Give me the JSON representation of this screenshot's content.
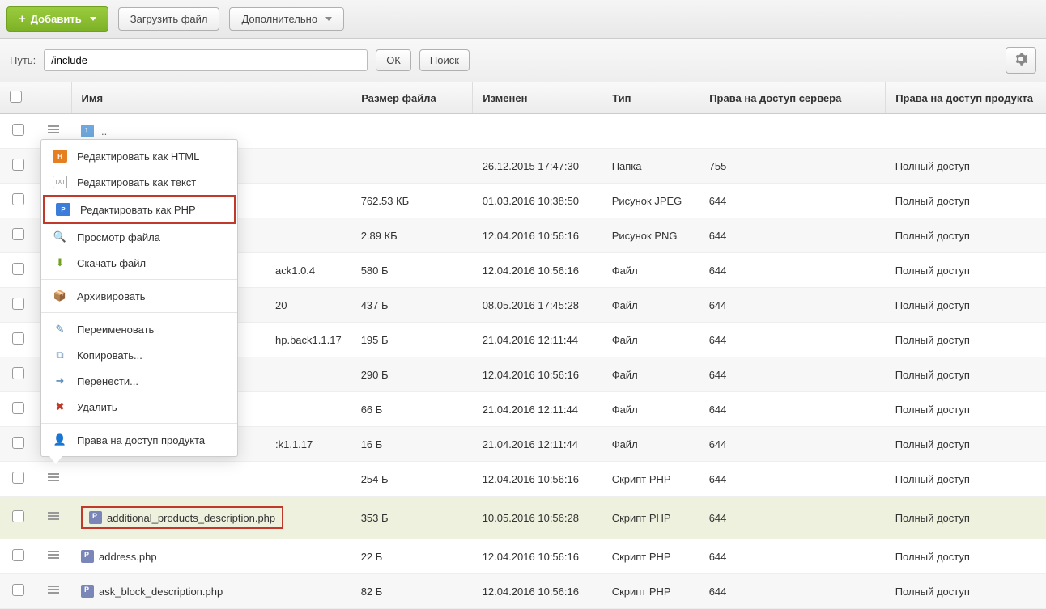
{
  "toolbar": {
    "add_label": "Добавить",
    "upload_label": "Загрузить файл",
    "more_label": "Дополнительно"
  },
  "pathbar": {
    "label": "Путь:",
    "value": "/include",
    "ok_label": "ОК",
    "search_label": "Поиск"
  },
  "columns": {
    "name": "Имя",
    "size": "Размер файла",
    "modified": "Изменен",
    "type": "Тип",
    "perm_server": "Права на доступ сервера",
    "perm_product": "Права на доступ продукта"
  },
  "parent_dots": "..",
  "rows": [
    {
      "name": "",
      "size": "",
      "modified": "26.12.2015 17:47:30",
      "type": "Папка",
      "perm_server": "755",
      "perm_product": "Полный доступ"
    },
    {
      "name": "",
      "size": "762.53 КБ",
      "modified": "01.03.2016 10:38:50",
      "type": "Рисунок JPEG",
      "perm_server": "644",
      "perm_product": "Полный доступ"
    },
    {
      "name": "",
      "size": "2.89 КБ",
      "modified": "12.04.2016 10:56:16",
      "type": "Рисунок PNG",
      "perm_server": "644",
      "perm_product": "Полный доступ"
    },
    {
      "name": "ack1.0.4",
      "size": "580 Б",
      "modified": "12.04.2016 10:56:16",
      "type": "Файл",
      "perm_server": "644",
      "perm_product": "Полный доступ"
    },
    {
      "name": "20",
      "size": "437 Б",
      "modified": "08.05.2016 17:45:28",
      "type": "Файл",
      "perm_server": "644",
      "perm_product": "Полный доступ"
    },
    {
      "name": "hp.back1.1.17",
      "size": "195 Б",
      "modified": "21.04.2016 12:11:44",
      "type": "Файл",
      "perm_server": "644",
      "perm_product": "Полный доступ"
    },
    {
      "name": "",
      "size": "290 Б",
      "modified": "12.04.2016 10:56:16",
      "type": "Файл",
      "perm_server": "644",
      "perm_product": "Полный доступ"
    },
    {
      "name": "",
      "size": "66 Б",
      "modified": "21.04.2016 12:11:44",
      "type": "Файл",
      "perm_server": "644",
      "perm_product": "Полный доступ"
    },
    {
      "name": ":k1.1.17",
      "size": "16 Б",
      "modified": "21.04.2016 12:11:44",
      "type": "Файл",
      "perm_server": "644",
      "perm_product": "Полный доступ"
    },
    {
      "name": "",
      "size": "254 Б",
      "modified": "12.04.2016 10:56:16",
      "type": "Скрипт PHP",
      "perm_server": "644",
      "perm_product": "Полный доступ"
    },
    {
      "name": "additional_products_description.php",
      "size": "353 Б",
      "modified": "10.05.2016 10:56:28",
      "type": "Скрипт PHP",
      "perm_server": "644",
      "perm_product": "Полный доступ",
      "highlighted": true
    },
    {
      "name": "address.php",
      "size": "22 Б",
      "modified": "12.04.2016 10:56:16",
      "type": "Скрипт PHP",
      "perm_server": "644",
      "perm_product": "Полный доступ"
    },
    {
      "name": "ask_block_description.php",
      "size": "82 Б",
      "modified": "12.04.2016 10:56:16",
      "type": "Скрипт PHP",
      "perm_server": "644",
      "perm_product": "Полный доступ"
    }
  ],
  "context_menu": {
    "edit_html": "Редактировать как HTML",
    "edit_text": "Редактировать как текст",
    "edit_php": "Редактировать как PHP",
    "view": "Просмотр файла",
    "download": "Скачать файл",
    "archive": "Архивировать",
    "rename": "Переименовать",
    "copy": "Копировать...",
    "move": "Перенести...",
    "delete": "Удалить",
    "perms": "Права на доступ продукта"
  }
}
